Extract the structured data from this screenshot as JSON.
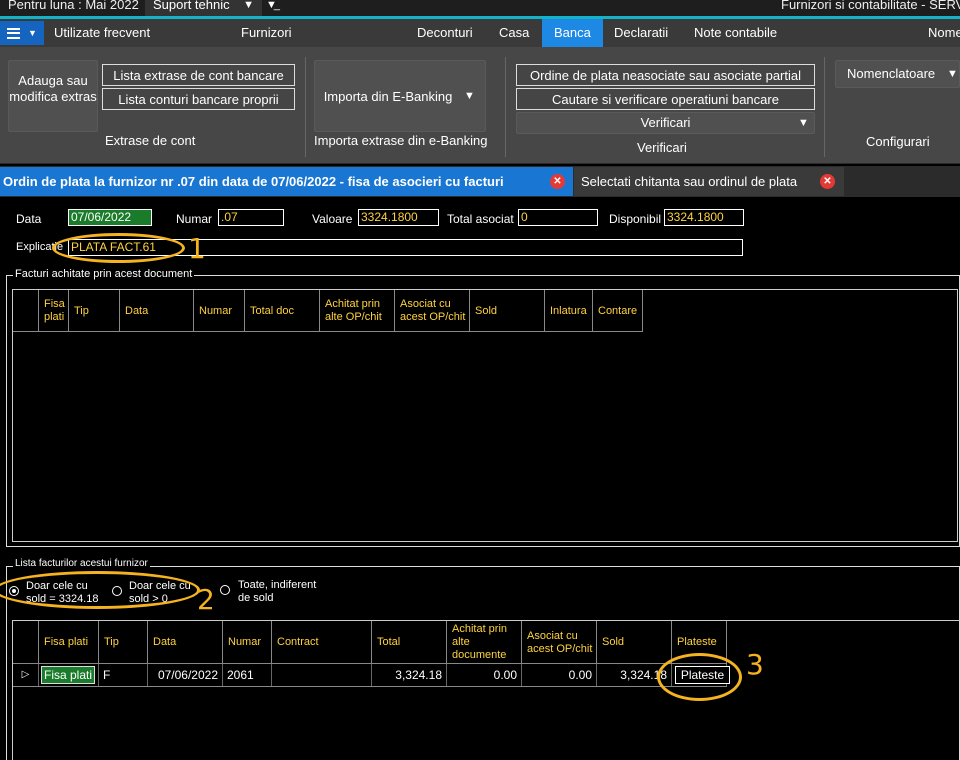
{
  "titlebar": {
    "period_label": "Pentru luna : Mai 2022",
    "support_label": "Suport tehnic",
    "app_title": "Furnizori si contabilitate - SERVI"
  },
  "ribbon_tabs": {
    "frequent": "Utilizate frecvent",
    "furnizori": "Furnizori",
    "deconturi": "Deconturi",
    "casa": "Casa",
    "banca": "Banca",
    "declaratii": "Declaratii",
    "note": "Note contabile",
    "nome": "Nome"
  },
  "ribbon": {
    "add_extras": "Adauga  sau modifica extras",
    "list_extrase": "Lista extrase de cont bancare",
    "list_conturi": "Lista conturi bancare proprii",
    "group_extrase": "Extrase de cont",
    "import_ebanking": "Importa din E-Banking",
    "group_import": "Importa extrase din e-Banking",
    "ordine": "Ordine de plata neasociate sau asociate partial",
    "cautare": "Cautare si verificare operatiuni bancare",
    "verificari_dd": "Verificari",
    "group_verificari": "Verificari",
    "nomenclatoare": "Nomenclatoare",
    "group_configurari": "Configurari"
  },
  "doc_tabs": {
    "active": "Ordin de plata la furnizor nr .07 din data de 07/06/2022 - fisa de asocieri cu facturi",
    "second": "Selectati chitanta sau ordinul de plata"
  },
  "form": {
    "data_label": "Data",
    "data_value": "07/06/2022",
    "numar_label": "Numar",
    "numar_value": ".07",
    "valoare_label": "Valoare",
    "valoare_value": "3324.1800",
    "total_label": "Total asociat",
    "total_value": "0",
    "disponibil_label": "Disponibil",
    "disponibil_value": "3324.1800",
    "explicatie_label": "Explicatie",
    "explicatie_value": "PLATA FACT.61"
  },
  "paid_grid": {
    "title": "Facturi achitate prin acest document",
    "columns": {
      "fisa": "Fisa plati",
      "tip": "Tip",
      "data": "Data",
      "numar": "Numar",
      "total": "Total doc",
      "achitat": "Achitat prin alte OP/chit",
      "asociat": "Asociat cu acest OP/chit",
      "sold": "Sold",
      "inlatura": "Inlatura",
      "contare": "Contare"
    }
  },
  "invoice_list": {
    "title": "Lista facturilor acestui furnizor",
    "radio_sold": "Doar cele cu sold = 3324.18",
    "radio_positive": "Doar cele cu sold > 0",
    "radio_all": "Toate, indiferent de sold",
    "columns": {
      "fisa": "Fisa plati",
      "tip": "Tip",
      "data": "Data",
      "numar": "Numar",
      "contract": "Contract",
      "total": "Total",
      "achitat": "Achitat prin alte documente",
      "asociat": "Asociat cu acest OP/chit",
      "sold": "Sold",
      "plateste": "Plateste"
    },
    "rows": [
      {
        "fisa": "Fisa plati",
        "tip": "F",
        "data": "07/06/2022",
        "numar": "2061",
        "contract": "",
        "total": "3,324.18",
        "achitat": "0.00",
        "asociat": "0.00",
        "sold": "3,324.18",
        "plateste": "Plateste"
      }
    ]
  },
  "annotations": {
    "one": "1",
    "two": "2",
    "three": "3"
  },
  "colors": {
    "accent": "#1e88e5",
    "highlight": "#f5b320",
    "field_text": "#ffd23f",
    "close": "#e53935"
  }
}
